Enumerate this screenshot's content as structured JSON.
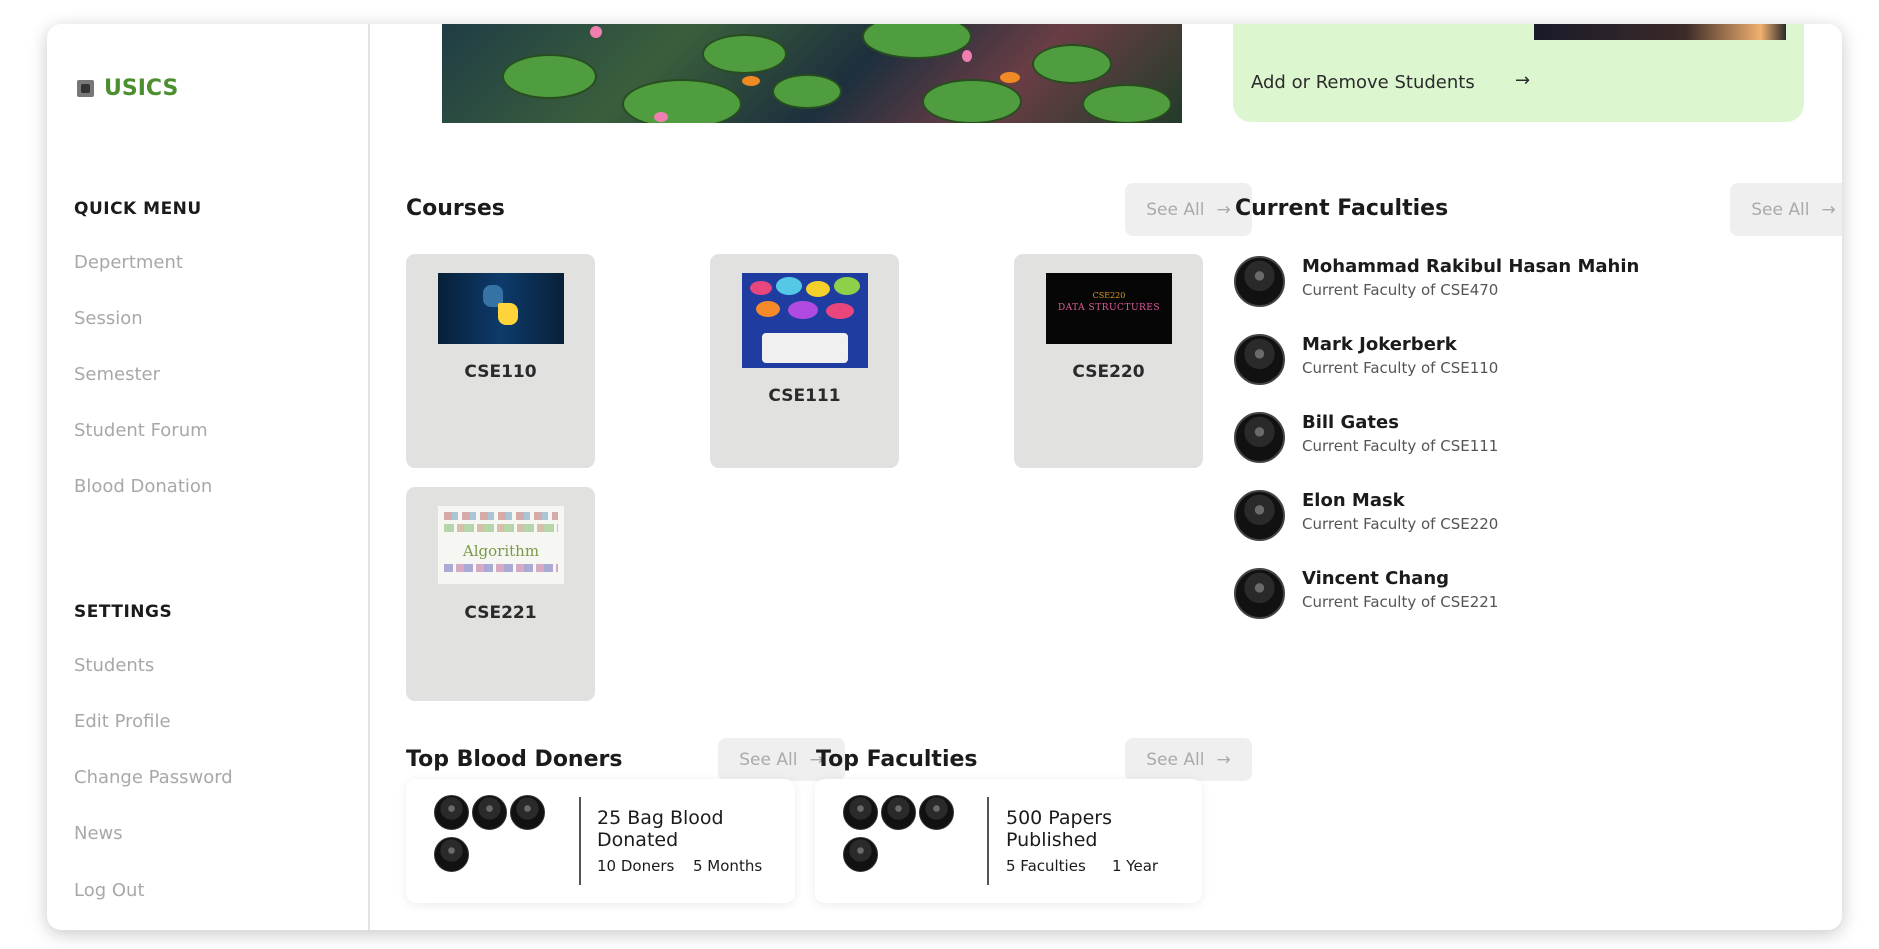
{
  "brand": {
    "name": "USICS",
    "color": "#4c8f2f"
  },
  "sidebar": {
    "quick_menu_title": "QUICK MENU",
    "quick_menu": [
      "Depertment",
      "Session",
      "Semester",
      "Student Forum",
      "Blood Donation"
    ],
    "settings_title": "SETTINGS",
    "settings": [
      "Students",
      "Edit Profile",
      "Change Password",
      "News",
      "Log Out"
    ]
  },
  "promo": {
    "label": "Add or Remove Students",
    "arrow": "→",
    "bg_color": "#dcf7cf"
  },
  "courses": {
    "title": "Courses",
    "see_all": "See All",
    "items": [
      {
        "code": "CSE110",
        "thumb": "python-icon"
      },
      {
        "code": "CSE111",
        "thumb": "programming-languages-icon"
      },
      {
        "code": "CSE220",
        "thumb": "data-structures-icon",
        "thumb_text_top": "CSE220",
        "thumb_text": "DATA STRUCTURES"
      },
      {
        "code": "CSE221",
        "thumb": "algorithm-wordcloud-icon",
        "thumb_text": "Algorithm"
      }
    ]
  },
  "current_faculties": {
    "title": "Current Faculties",
    "see_all": "See All",
    "items": [
      {
        "name": "Mohammad Rakibul Hasan Mahin",
        "role": "Current Faculty of CSE470"
      },
      {
        "name": "Mark Jokerberk",
        "role": "Current Faculty of CSE110"
      },
      {
        "name": "Bill Gates",
        "role": "Current Faculty of CSE111"
      },
      {
        "name": "Elon Mask",
        "role": "Current Faculty of CSE220"
      },
      {
        "name": "Vincent Chang",
        "role": "Current Faculty of CSE221"
      }
    ]
  },
  "top_blood_doners": {
    "title": "Top Blood Doners",
    "see_all": "See All",
    "headline": "25 Bag Blood Donated",
    "stat1": "10 Doners",
    "stat2": "5 Months"
  },
  "top_faculties": {
    "title": "Top Faculties",
    "see_all": "See All",
    "headline": "500 Papers Published",
    "stat1": "5 Faculties",
    "stat2": "1 Year"
  },
  "arrow_glyph": "→"
}
